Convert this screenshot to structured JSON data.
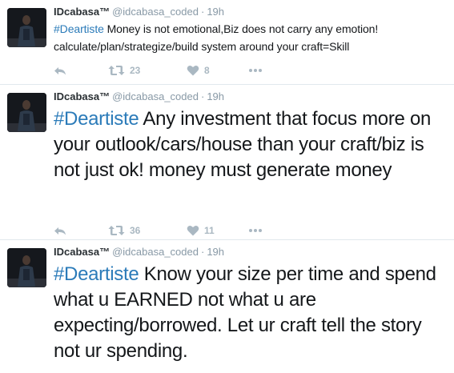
{
  "tweets": [
    {
      "name": "IDcabasa™",
      "handle": "@idcabasa_coded",
      "separator": "·",
      "time": "19h",
      "hashtag": "#Deartiste",
      "text": " Money is not emotional,Biz does not carry any emotion! calculate/plan/strategize/build system around your craft=Skill",
      "retweets": "23",
      "likes": "8"
    },
    {
      "name": "IDcabasa™",
      "handle": "@idcabasa_coded",
      "separator": "·",
      "time": "19h",
      "hashtag": "#Deartiste",
      "text": " Any investment that focus more on your outlook/cars/house than your craft/biz is not just ok! money must generate money",
      "retweets": "36",
      "likes": "11"
    },
    {
      "name": "IDcabasa™",
      "handle": "@idcabasa_coded",
      "separator": "·",
      "time": "19h",
      "hashtag": "#Deartiste",
      "text": " Know your size per time and spend what u EARNED not what u are expecting/borrowed. Let ur craft tell the story not ur spending."
    }
  ],
  "icons": {
    "reply": "reply-icon",
    "retweet": "retweet-icon",
    "like": "heart-icon",
    "more": "more-icon"
  },
  "colors": {
    "hashtag": "#2b7bb9",
    "action_gray": "#aab8c2",
    "meta_gray": "#8899a6",
    "divider": "#e1e8ed"
  }
}
